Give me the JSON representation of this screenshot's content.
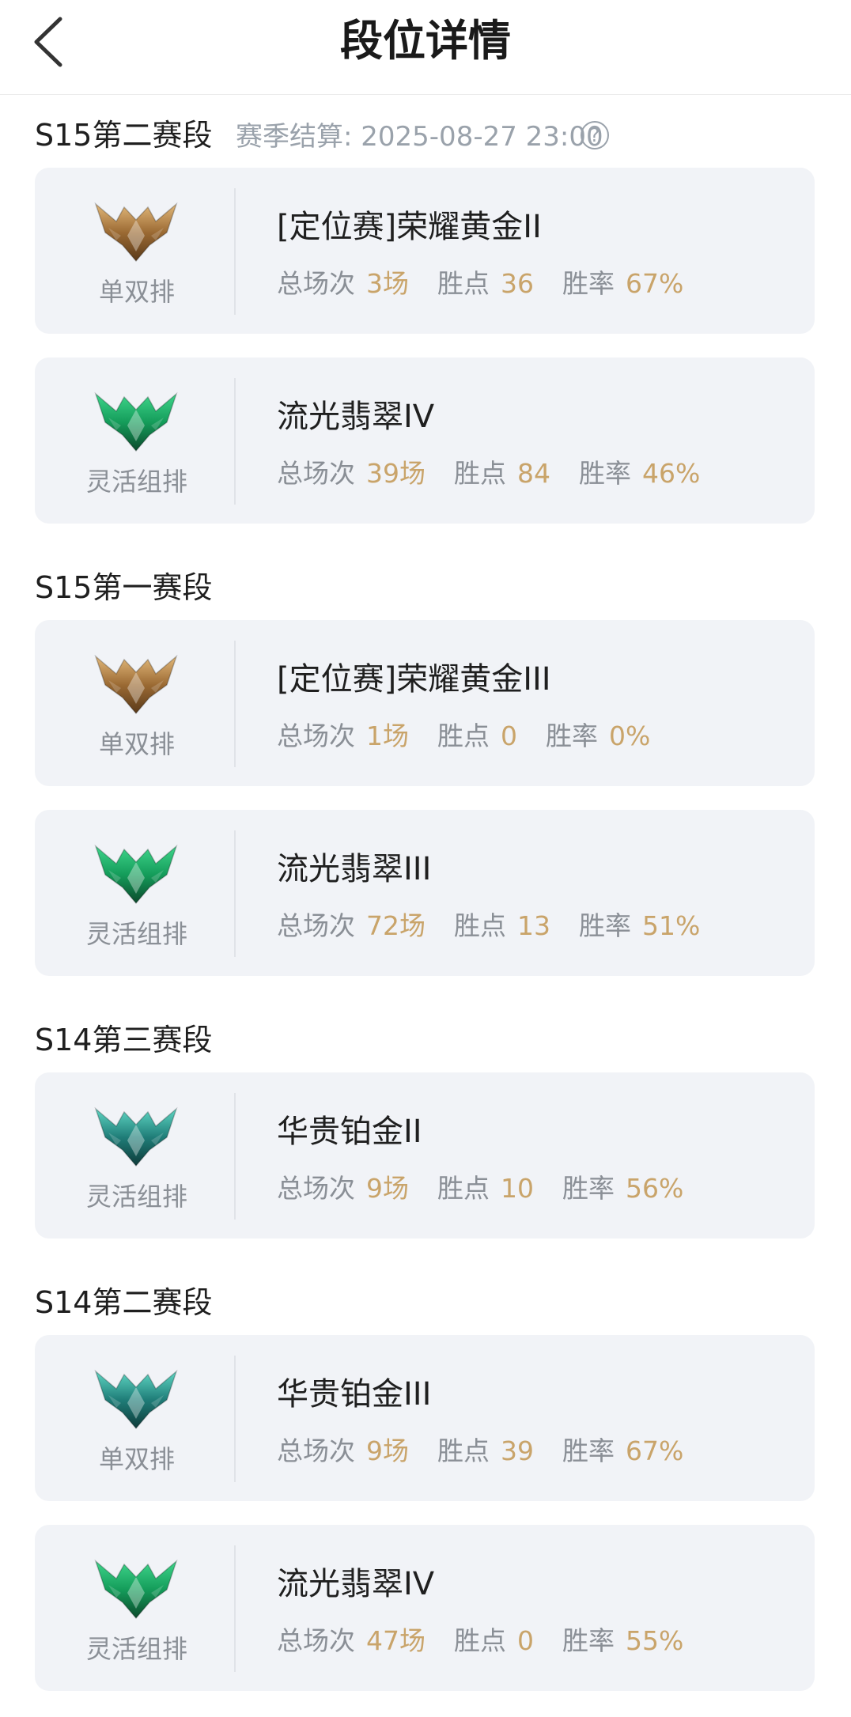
{
  "header": {
    "title": "段位详情"
  },
  "labels": {
    "games": "总场次",
    "points": "胜点",
    "winrate": "胜率"
  },
  "colors": {
    "value": "#c9a46a",
    "label": "#8a8f96",
    "card_bg": "#f1f3f7",
    "settle": "#9aa2ab"
  },
  "seasons": [
    {
      "name": "S15第二赛段",
      "settlement": "赛季结算: 2025-08-27 23:00",
      "entries": [
        {
          "queue": "单双排",
          "rank": "[定位赛]荣耀黄金II",
          "games": "3场",
          "points": "36",
          "winrate": "67%",
          "emblem": "gold-emblem-icon"
        },
        {
          "queue": "灵活组排",
          "rank": "流光翡翠IV",
          "games": "39场",
          "points": "84",
          "winrate": "46%",
          "emblem": "emerald-emblem-icon"
        }
      ]
    },
    {
      "name": "S15第一赛段",
      "entries": [
        {
          "queue": "单双排",
          "rank": "[定位赛]荣耀黄金III",
          "games": "1场",
          "points": "0",
          "winrate": "0%",
          "emblem": "gold-emblem-icon"
        },
        {
          "queue": "灵活组排",
          "rank": "流光翡翠III",
          "games": "72场",
          "points": "13",
          "winrate": "51%",
          "emblem": "emerald-emblem-icon"
        }
      ]
    },
    {
      "name": "S14第三赛段",
      "entries": [
        {
          "queue": "灵活组排",
          "rank": "华贵铂金II",
          "games": "9场",
          "points": "10",
          "winrate": "56%",
          "emblem": "platinum-emblem-icon"
        }
      ]
    },
    {
      "name": "S14第二赛段",
      "entries": [
        {
          "queue": "单双排",
          "rank": "华贵铂金III",
          "games": "9场",
          "points": "39",
          "winrate": "67%",
          "emblem": "platinum-emblem-icon"
        },
        {
          "queue": "灵活组排",
          "rank": "流光翡翠IV",
          "games": "47场",
          "points": "0",
          "winrate": "55%",
          "emblem": "emerald-emblem-icon"
        }
      ]
    }
  ]
}
